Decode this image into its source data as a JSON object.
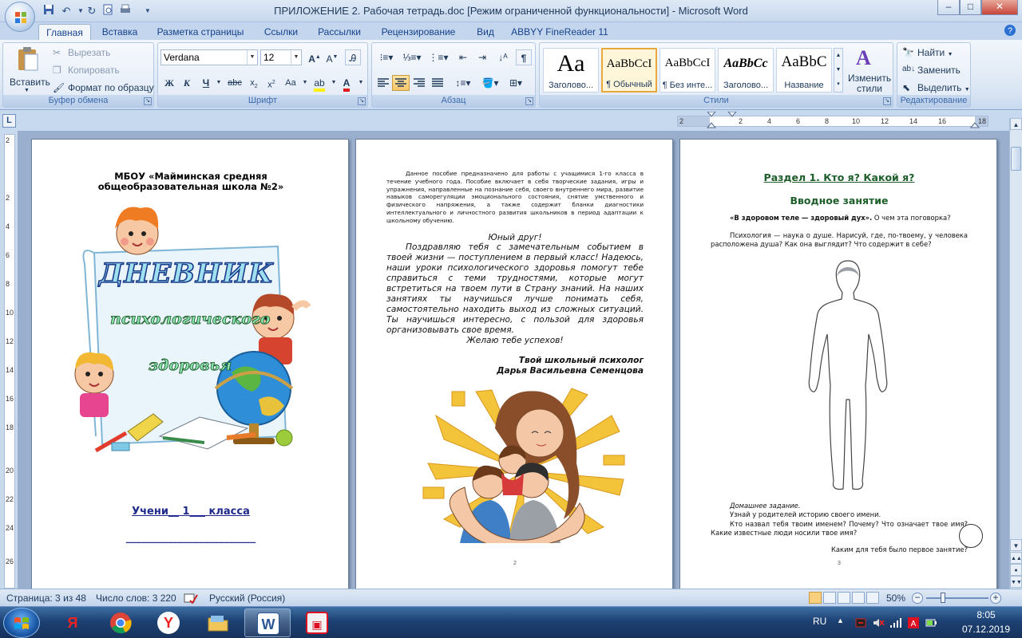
{
  "window": {
    "title": "ПРИЛОЖЕНИЕ 2. Рабочая тетрадь.doc [Режим ограниченной функциональности] - Microsoft Word",
    "minimize": "–",
    "maximize": "□",
    "close": "✕"
  },
  "tabs": [
    "Главная",
    "Вставка",
    "Разметка страницы",
    "Ссылки",
    "Рассылки",
    "Рецензирование",
    "Вид",
    "ABBYY FineReader 11"
  ],
  "ribbon": {
    "clipboard": {
      "label": "Буфер обмена",
      "paste": "Вставить",
      "cut": "Вырезать",
      "copy": "Копировать",
      "format_painter": "Формат по образцу"
    },
    "font": {
      "label": "Шрифт",
      "font_name": "Verdana",
      "font_size": "12"
    },
    "paragraph": {
      "label": "Абзац"
    },
    "styles": {
      "label": "Стили",
      "items": [
        {
          "sample": "Aa",
          "name": "Заголово..."
        },
        {
          "sample": "AaBbCcI",
          "name": "¶ Обычный"
        },
        {
          "sample": "AaBbCcI",
          "name": "¶ Без инте..."
        },
        {
          "sample": "AaBbCc",
          "name": "Заголово..."
        },
        {
          "sample": "AaBbC",
          "name": "Название"
        }
      ],
      "change_styles": "Изменить стили"
    },
    "editing": {
      "label": "Редактирование",
      "find": "Найти",
      "replace": "Заменить",
      "select": "Выделить"
    }
  },
  "ruler": {
    "h_ticks": [
      "2",
      "2",
      "4",
      "6",
      "8",
      "10",
      "12",
      "14",
      "16",
      "18"
    ],
    "v_ticks": [
      "2",
      "2",
      "4",
      "6",
      "8",
      "10",
      "12",
      "14",
      "16",
      "18",
      "20",
      "22",
      "24",
      "26"
    ]
  },
  "page1": {
    "school_line1": "МБОУ «Майминская средняя",
    "school_line2": "общеобразовательная школа №2»",
    "diary_title": "ДНЕВНИК",
    "diary_sub1": "психологического",
    "diary_sub2": "здоровья",
    "student_line": "Учени__ 1___ класса",
    "name_line": "_________________________"
  },
  "page2": {
    "intro": "Данное пособие предназначено для работы с учащимися 1-го класса в течение учебного года. Пособие включает в себя творческие задания, игры и упражнения, направленные на познание себя, своего внутреннего мира, развитие навыков саморегуляции эмоционального состояния, снятие умственного и физического напряжения, а также содержит бланки диагностики интеллектуального и личностного развития школьников в период адаптации к школьному обучению.",
    "greeting": "Юный друг!",
    "body": "Поздравляю тебя с замечательным событием в твоей жизни — поступлением в первый класс! Надеюсь, наши уроки психологического здоровья помогут тебе справиться с теми трудностями, которые могут встретиться на твоем пути в Страну знаний. На наших занятиях ты научишься лучше понимать себя, самостоятельно находить выход из сложных ситуаций. Ты научишься интересно, с пользой для здоровья организовывать свое время.",
    "wish": "Желаю тебе успехов!",
    "sign1": "Твой школьный психолог",
    "sign2": "Дарья Васильевна Семенцова",
    "page_number": "2"
  },
  "page3": {
    "section_title": "Раздел 1. Кто я? Какой я?",
    "lesson_title": "Вводное занятие",
    "proverb_bold": "«В здоровом теле — здоровый дух».",
    "proverb_rest": "О чем эта поговорка?",
    "question": "Психология — наука о душе. Нарисуй, где, по-твоему, у человека расположена душа? Как она выглядит? Что содержит в себе?",
    "homework_title": "Домашнее задание.",
    "homework1": "Узнай у родителей историю своего имени.",
    "homework2": "Кто назвал тебя твоим именем? Почему? Что означает твое имя? Какие известные люди носили твое имя?",
    "last_question": "Каким для тебя было первое занятие?",
    "page_number": "3"
  },
  "status": {
    "page": "Страница: 3 из 48",
    "words": "Число слов: 3 220",
    "language": "Русский (Россия)",
    "zoom": "50%"
  },
  "taskbar": {
    "lang": "RU",
    "time": "8:05",
    "date": "07.12.2019"
  },
  "colors": {
    "accent": "#15428b",
    "page_bg": "#ffffff",
    "doc_bg": "#9aafcd",
    "heading_green": "#1d5e2b",
    "link_blue": "#1f2a8c"
  }
}
